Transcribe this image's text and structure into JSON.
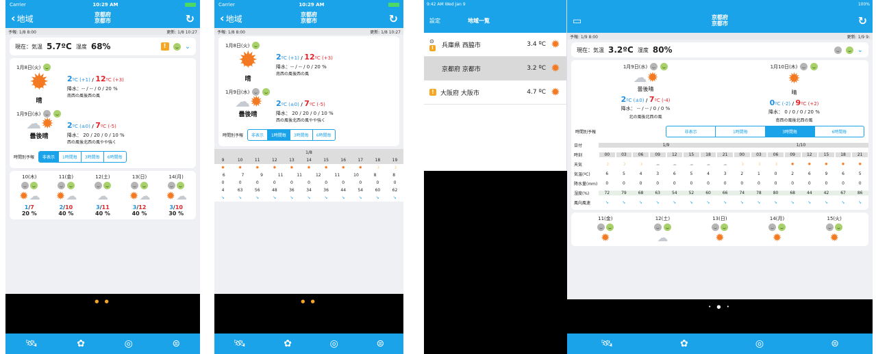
{
  "phone1": {
    "status": {
      "carrier": "Carrier",
      "time": "10:29 AM"
    },
    "nav": {
      "back": "地域",
      "title1": "京都府",
      "title2": "京都市"
    },
    "info": {
      "forecast": "予報: 1/8 8:00",
      "updated": "更新: 1/8 10:27"
    },
    "current": {
      "label": "現在：気温",
      "temp": "5.7ºC",
      "hum_label": "湿度",
      "hum": "68%"
    },
    "day1": {
      "date": "1月8日(火)",
      "weather": "晴",
      "lo": "2",
      "lo_diff": "ºC (+1)",
      "sep": " / ",
      "hi": "12",
      "hi_diff": "ºC (+3)",
      "rain": "降水：-- / -- / 0 / 20 %",
      "wind": "南西の風後西の風"
    },
    "day2": {
      "date": "1月9日(水)",
      "weather": "曇後晴",
      "lo": "2",
      "lo_diff": "ºC (±0)",
      "sep": " / ",
      "hi": "7",
      "hi_diff": "ºC (-5)",
      "rain": "降水： 20 / 20 / 0 / 10 %",
      "wind": "西の風後北西の風やや強く"
    },
    "seg": {
      "label": "時間別予報",
      "opts": [
        "非表示",
        "1時間毎",
        "3時間毎",
        "6時間毎"
      ]
    },
    "week": [
      {
        "d": "10(木)",
        "lo": "1",
        "hi": "7",
        "p": "20 %"
      },
      {
        "d": "11(金)",
        "lo": "2",
        "hi": "10",
        "p": "40 %"
      },
      {
        "d": "12(土)",
        "lo": "3",
        "hi": "11",
        "p": "40 %"
      },
      {
        "d": "13(日)",
        "lo": "3",
        "hi": "12",
        "p": "40 %"
      },
      {
        "d": "14(月)",
        "lo": "3",
        "hi": "10",
        "p": "30 %"
      }
    ],
    "temp_sep": "/"
  },
  "phone2": {
    "date": "1/8",
    "hours": [
      "9",
      "10",
      "11",
      "12",
      "13",
      "14",
      "15",
      "16",
      "17",
      "18",
      "19"
    ],
    "temps": [
      "6",
      "7",
      "9",
      "11",
      "11",
      "12",
      "11",
      "10",
      "8",
      "8"
    ],
    "rain": [
      "0",
      "0",
      "0",
      "0",
      "0",
      "0",
      "0",
      "0",
      "0",
      "0",
      "0"
    ],
    "hum": [
      "4",
      "63",
      "56",
      "48",
      "36",
      "34",
      "36",
      "44",
      "54",
      "60",
      "62"
    ]
  },
  "ipad": {
    "status": {
      "time": "9:42 AM  Wed Jan 9",
      "battery": "100%"
    },
    "sidebar": {
      "settings": "設定",
      "title": "地域一覧",
      "items": [
        {
          "name": "兵庫県 西脇市",
          "temp": "3.4 ºC"
        },
        {
          "name": "京都府 京都市",
          "temp": "3.2 ºC"
        },
        {
          "name": "大阪府 大阪市",
          "temp": "4.7 ºC"
        }
      ]
    },
    "nav": {
      "title1": "京都府",
      "title2": "京都市"
    },
    "info": {
      "forecast": "予報: 1/9 8:00",
      "updated": "更新: 1/9 9:"
    },
    "current": {
      "label": "現在：気温",
      "temp": "3.2ºC",
      "hum_label": "湿度",
      "hum": "80%"
    },
    "dayA": {
      "date": "1月9日(水)",
      "weather": "曇後晴",
      "lo": "2",
      "lo_diff": "ºC (±0)",
      "hi": "7",
      "hi_diff": "ºC (-4)",
      "rain": "降水： -- / -- / 0 / 0 %",
      "wind": "北の風後北西の風"
    },
    "dayB": {
      "date": "1月10日(木)",
      "weather": "晴",
      "lo": "0",
      "lo_diff": "ºC (-2)",
      "hi": "9",
      "hi_diff": "ºC (+2)",
      "rain": "降水： 0 / 0 / 0 / 20 %",
      "wind": "南西の風後北西の風"
    },
    "seg": {
      "label": "時間別予報",
      "opts": [
        "非表示",
        "1時間毎",
        "3時間毎",
        "6時間毎"
      ]
    },
    "table": {
      "row_labels": [
        "日付",
        "時刻",
        "天気",
        "気温(ºC)",
        "降水量(mm)",
        "湿度(%)",
        "風向風速"
      ],
      "date1": "1/9",
      "date2": "1/10",
      "times": [
        "00",
        "03",
        "06",
        "09",
        "12",
        "15",
        "18",
        "21",
        "00",
        "03",
        "06",
        "09",
        "12",
        "15",
        "18",
        "21"
      ],
      "temps": [
        "6",
        "5",
        "4",
        "3",
        "6",
        "5",
        "4",
        "3",
        "2",
        "1",
        "0",
        "2",
        "6",
        "9",
        "6",
        "5"
      ],
      "rain": [
        "0",
        "0",
        "0",
        "0",
        "0",
        "0",
        "0",
        "0",
        "0",
        "0",
        "0",
        "0",
        "0",
        "0",
        "0",
        "0"
      ],
      "hum": [
        "72",
        "79",
        "68",
        "63",
        "54",
        "52",
        "60",
        "66",
        "74",
        "78",
        "80",
        "68",
        "44",
        "42",
        "67",
        "86"
      ]
    },
    "week": [
      {
        "d": "11(金)"
      },
      {
        "d": "12(土)"
      },
      {
        "d": "13(日)"
      },
      {
        "d": "14(月)"
      },
      {
        "d": "15(火)"
      }
    ]
  }
}
